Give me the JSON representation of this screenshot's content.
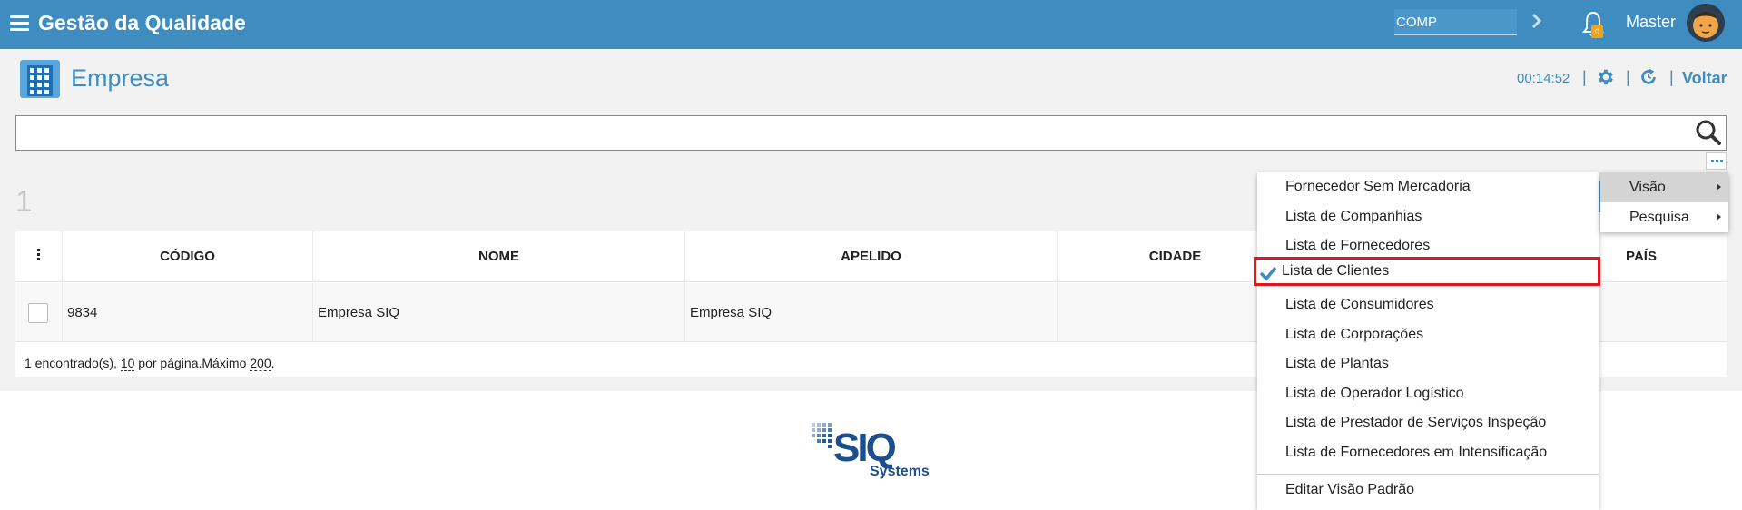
{
  "topbar": {
    "title": "Gestão da Qualidade",
    "company_input_value": "COMP",
    "notification_count": "0",
    "user_name": "Master"
  },
  "page": {
    "title": "Empresa",
    "timer": "00:14:52",
    "separator": "|",
    "back_label": "Voltar"
  },
  "search": {
    "value": ""
  },
  "result_count": "1",
  "table": {
    "headers": [
      "CÓDIGO",
      "NOME",
      "APELIDO",
      "CIDADE",
      "PAÍS"
    ],
    "rows": [
      {
        "codigo": "9834",
        "nome": "Empresa SIQ",
        "apelido": "Empresa SIQ",
        "cidade": "",
        "pais": ""
      }
    ],
    "footer": {
      "found_text": "1 encontrado(s), ",
      "per_page_value": "10",
      "per_page_text": " por página.Máximo ",
      "max_value": "200",
      "end": "."
    }
  },
  "view_menu": {
    "items": [
      "Fornecedor Sem Mercadoria",
      "Lista de Companhias",
      "Lista de Fornecedores",
      "Lista de Clientes",
      "Lista de Consumidores",
      "Lista de Corporações",
      "Lista de Plantas",
      "Lista de Operador Logístico",
      "Lista de Prestador de Serviços Inspeção",
      "Lista de Fornecedores em Intensificação"
    ],
    "selected": "Lista de Clientes",
    "edit_default": "Editar Visão Padrão"
  },
  "submenu": {
    "items": [
      "Visão",
      "Pesquisa"
    ]
  },
  "logo": {
    "text": "SIQ",
    "subtext": "Systems"
  },
  "colors": {
    "primary": "#3f8cc0",
    "highlight": "#e4141e",
    "badge": "#f4a21a"
  }
}
